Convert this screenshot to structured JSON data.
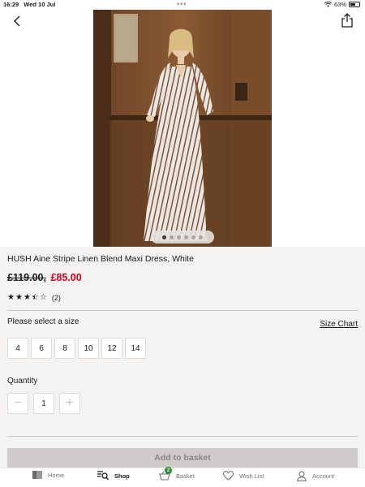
{
  "status_bar": {
    "time": "16:29",
    "date": "Wed 10 Jul",
    "battery": "63%"
  },
  "product": {
    "title": "HUSH Aine Stripe Linen Blend Maxi Dress, White",
    "price_was": "£119.00,",
    "price_now": "£85.00",
    "rating": {
      "value": 3.5,
      "max": 5,
      "count_text": "(2)"
    },
    "gallery": {
      "image_count": 6,
      "active_index": 0
    }
  },
  "sizes": {
    "label": "Please select a size",
    "chart_link": "Size Chart",
    "options": [
      "4",
      "6",
      "8",
      "10",
      "12",
      "14"
    ]
  },
  "quantity": {
    "label": "Quantity",
    "value": "1",
    "minus": "−",
    "plus": "+"
  },
  "add_to_basket": "Add to basket",
  "tabbar": {
    "home": "Home",
    "shop": "Shop",
    "basket": "Basket",
    "basket_count": "2",
    "wishlist": "Wish List",
    "account": "Account"
  },
  "colors": {
    "sale_red": "#d6001c",
    "badge_green": "#2e8b3a",
    "disabled_button": "#cfcbcb"
  }
}
